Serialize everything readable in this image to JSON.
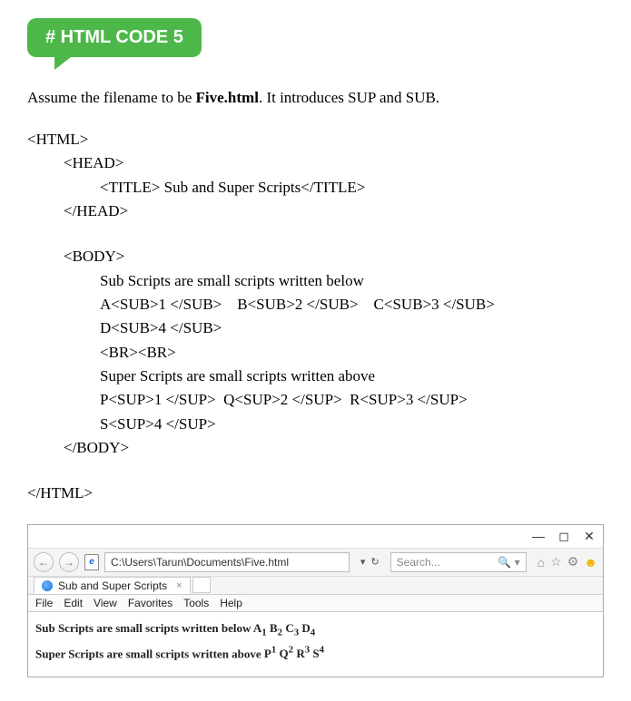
{
  "badge": {
    "text": "# HTML CODE 5"
  },
  "intro": {
    "prefix": "Assume the filename to be ",
    "filename": "Five.html",
    "suffix": ". It introduces SUP and SUB."
  },
  "code": {
    "l01": "<HTML>",
    "l02": "<HEAD>",
    "l03": "<TITLE> Sub and Super Scripts</TITLE>",
    "l04": "</HEAD>",
    "l05": "<BODY>",
    "l06": "Sub Scripts are small scripts written below",
    "l07": "A<SUB>1 </SUB>    B<SUB>2 </SUB>    C<SUB>3 </SUB>",
    "l08": "D<SUB>4 </SUB>",
    "l09": "<BR><BR>",
    "l10": "Super Scripts are small scripts written above",
    "l11": "P<SUP>1 </SUP>  Q<SUP>2 </SUP>  R<SUP>3 </SUP>",
    "l12": "S<SUP>4 </SUP>",
    "l13": "</BODY>",
    "l14": "</HTML>"
  },
  "browser": {
    "titlebar": {
      "min": "—",
      "max": "◻",
      "close": "✕"
    },
    "nav": {
      "back": "←",
      "fwd": "→"
    },
    "url": "C:\\Users\\Tarun\\Documents\\Five.html",
    "url_controls": {
      "dropdown": "▾",
      "refresh": "↻"
    },
    "search": {
      "placeholder": "Search...",
      "mag": "🔍",
      "drop": "▾"
    },
    "toolbar_icons": {
      "home": "⌂",
      "fav": "☆",
      "gear": "⚙",
      "smile": "☻"
    },
    "tab": {
      "title": "Sub and Super Scripts",
      "close": "×"
    },
    "menu": {
      "file": "File",
      "edit": "Edit",
      "view": "View",
      "favorites": "Favorites",
      "tools": "Tools",
      "help": "Help"
    },
    "page": {
      "sub_label": "Sub Scripts are small scripts written below ",
      "A": "A",
      "s1": "1",
      "B": "B",
      "s2": "2",
      "C": "C",
      "s3": "3",
      "D": "D",
      "s4": "4",
      "sup_label": "Super Scripts are small scripts written above ",
      "P": "P",
      "p1": "1",
      "Q": "Q",
      "p2": "2",
      "R": "R",
      "p3": "3",
      "S": "S",
      "p4": "4"
    }
  }
}
